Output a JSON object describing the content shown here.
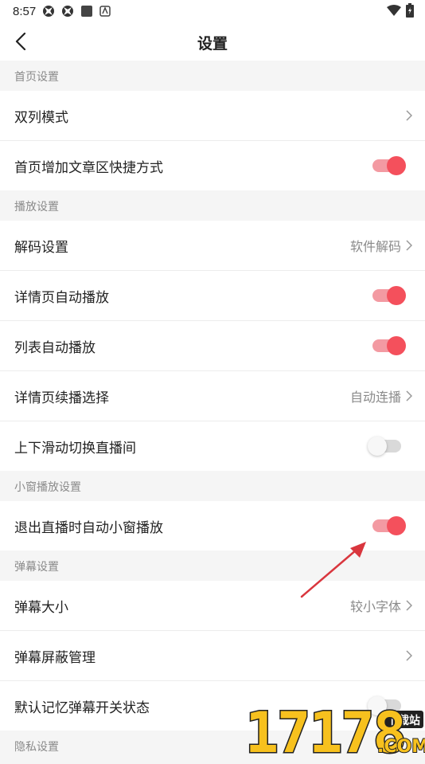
{
  "status_bar": {
    "time": "8:57"
  },
  "header": {
    "title": "设置"
  },
  "sections": [
    {
      "title": "首页设置",
      "items": [
        {
          "label": "双列模式",
          "type": "nav",
          "value": ""
        },
        {
          "label": "首页增加文章区快捷方式",
          "type": "toggle",
          "on": true
        }
      ]
    },
    {
      "title": "播放设置",
      "items": [
        {
          "label": "解码设置",
          "type": "nav",
          "value": "软件解码"
        },
        {
          "label": "详情页自动播放",
          "type": "toggle",
          "on": true
        },
        {
          "label": "列表自动播放",
          "type": "toggle",
          "on": true
        },
        {
          "label": "详情页续播选择",
          "type": "nav",
          "value": "自动连播"
        },
        {
          "label": "上下滑动切换直播间",
          "type": "toggle",
          "on": false
        }
      ]
    },
    {
      "title": "小窗播放设置",
      "items": [
        {
          "label": "退出直播时自动小窗播放",
          "type": "toggle",
          "on": true
        }
      ]
    },
    {
      "title": "弹幕设置",
      "items": [
        {
          "label": "弹幕大小",
          "type": "nav",
          "value": "较小字体"
        },
        {
          "label": "弹幕屏蔽管理",
          "type": "nav",
          "value": ""
        },
        {
          "label": "默认记忆弹幕开关状态",
          "type": "toggle",
          "on": false
        }
      ]
    },
    {
      "title": "隐私设置",
      "items": []
    }
  ],
  "watermark": {
    "text": "17178",
    "badge": "下载站",
    "domain": ".COM"
  },
  "colors": {
    "accent": "#f4505c",
    "accent_track": "#f39aa2",
    "off_track": "#d9d9d9",
    "section_text": "#8a8a8a",
    "background": "#f5f5f5"
  },
  "icons": [
    "back-arrow-icon",
    "chevron-right-icon",
    "wifi-icon",
    "battery-icon",
    "annotation-arrow-icon"
  ]
}
